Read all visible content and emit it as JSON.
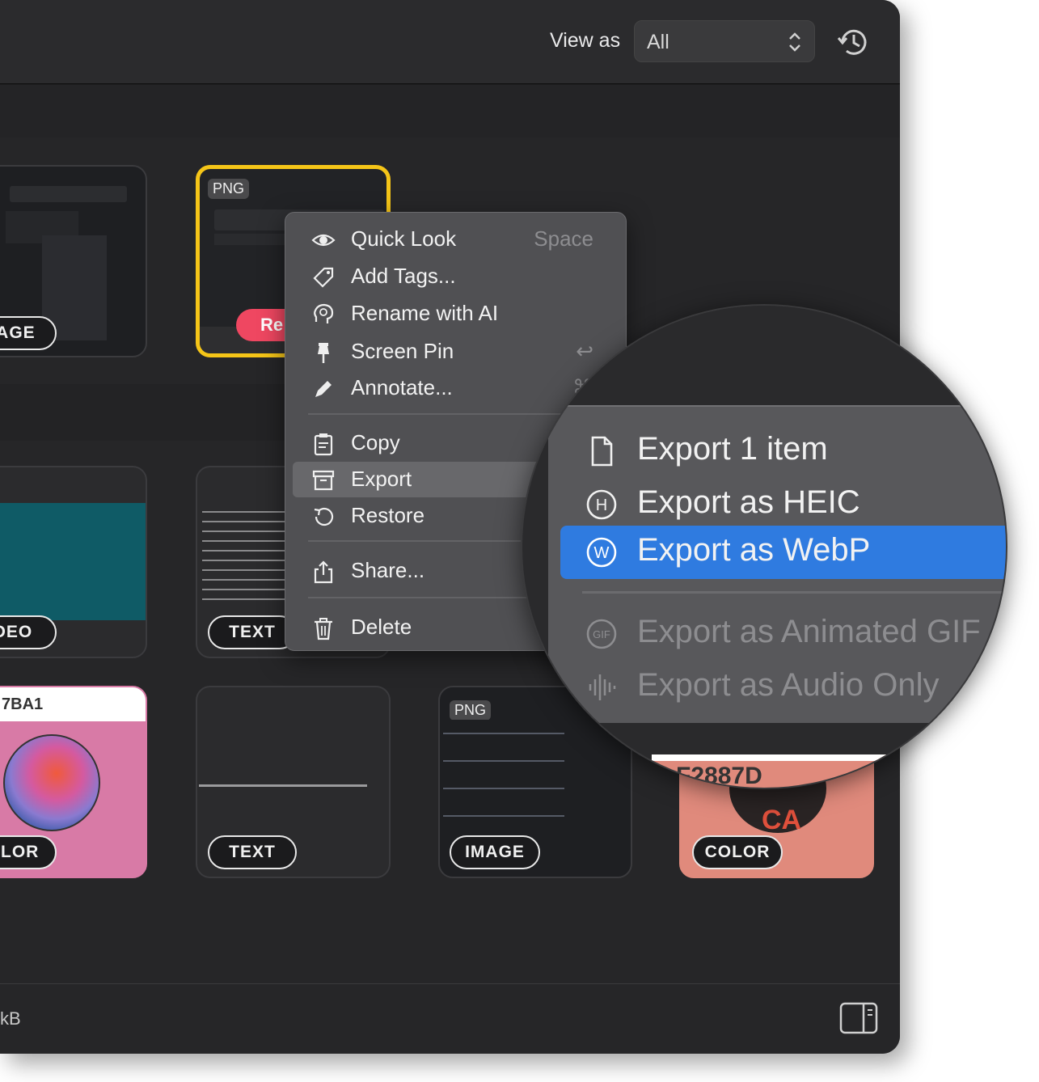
{
  "toolbar": {
    "view_as_label": "View as",
    "view_as_value": "All"
  },
  "cards": [
    {
      "format": "",
      "type_badge": "IMAGE",
      "type_badge_visible": "IAGE"
    },
    {
      "format": "PNG",
      "type_badge": "",
      "overlay_text": "Re"
    },
    {
      "type_badge_visible": "DEO"
    },
    {
      "type_badge": "TEXT"
    },
    {
      "title_visible": "7BA1",
      "type_badge_visible": "OLOR"
    },
    {
      "type_badge": "TEXT"
    },
    {
      "format": "PNG",
      "type_badge": "IMAGE"
    },
    {
      "title_visible": "F2887D",
      "type_badge": "COLOR",
      "overlay_text": "CA"
    }
  ],
  "context_menu": {
    "items": [
      {
        "label": "Quick Look",
        "shortcut": "Space",
        "icon": "eye-icon"
      },
      {
        "label": "Add Tags...",
        "icon": "tag-icon"
      },
      {
        "label": "Rename with AI",
        "icon": "brain-icon"
      },
      {
        "label": "Screen Pin",
        "shortcut": "↩",
        "icon": "pin-icon"
      },
      {
        "label": "Annotate...",
        "shortcut": "⌘",
        "icon": "pen-icon"
      },
      {
        "label": "Copy",
        "icon": "clipboard-icon"
      },
      {
        "label": "Export",
        "icon": "archive-icon",
        "highlighted": true
      },
      {
        "label": "Restore",
        "icon": "restore-icon"
      },
      {
        "label": "Share...",
        "icon": "share-icon"
      },
      {
        "label": "Delete",
        "icon": "trash-icon"
      }
    ]
  },
  "export_submenu": {
    "items": [
      {
        "label": "Export 1 item",
        "icon": "document-icon",
        "enabled": true
      },
      {
        "label": "Export as HEIC",
        "icon": "heic-icon",
        "enabled": true
      },
      {
        "label": "Export as WebP",
        "icon": "webp-icon",
        "enabled": true,
        "selected": true
      },
      {
        "label": "Export as Animated GIF",
        "icon": "gif-icon",
        "enabled": false
      },
      {
        "label": "Export as Audio Only",
        "icon": "waveform-icon",
        "enabled": false
      }
    ]
  },
  "footer": {
    "size_text": "kB"
  },
  "colors": {
    "selection_border": "#f5c518",
    "menu_highlight": "#2f7be0",
    "color_card_pink": "#d87aa6",
    "color_card_salmon": "#e08a7c"
  }
}
